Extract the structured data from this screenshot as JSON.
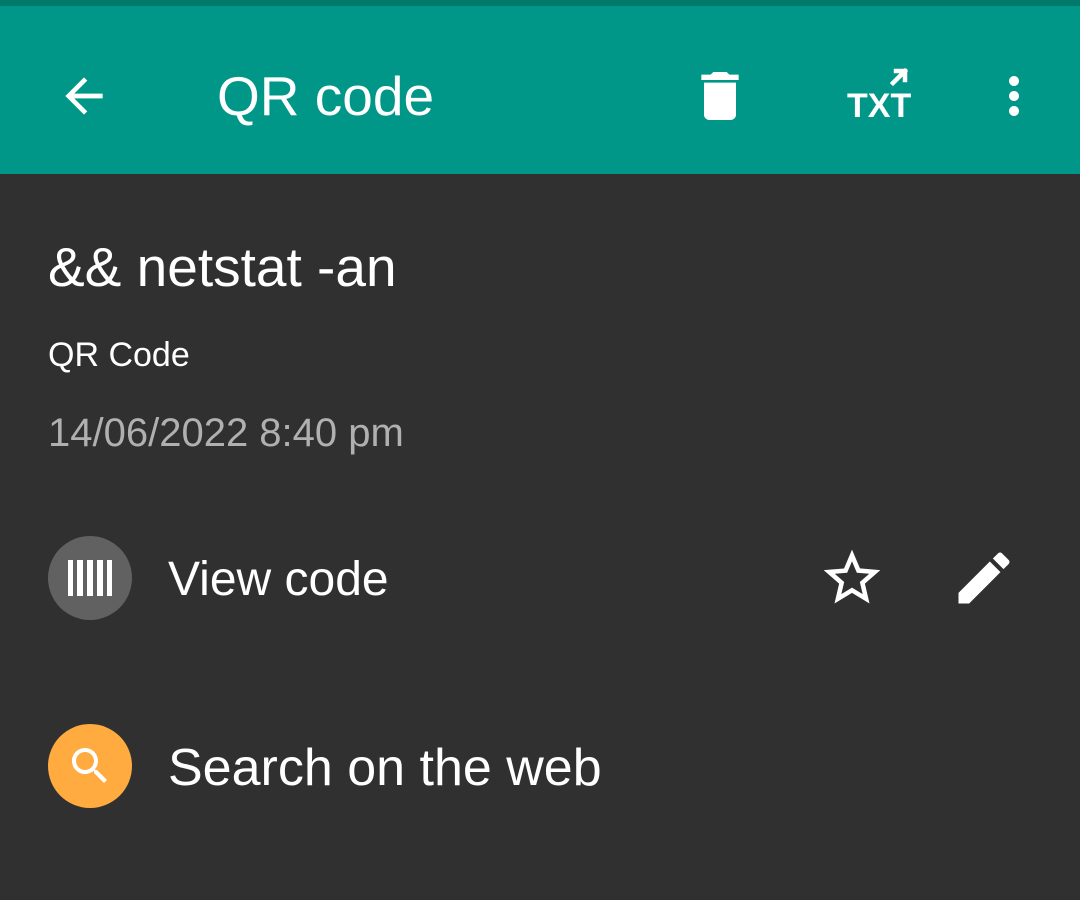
{
  "app_bar": {
    "title": "QR code",
    "background": "#009688",
    "txt_label": "TXT",
    "icons": {
      "back": "arrow-left-icon",
      "delete": "trash-icon",
      "export_txt": "txt-export-icon",
      "more": "more-vert-icon"
    }
  },
  "content": {
    "text": "&& netstat -an",
    "format": "QR Code",
    "date": "14/06/2022 8:40 pm"
  },
  "actions": {
    "view_code": {
      "label": "View code",
      "icon": "barcode-icon",
      "icon_bg": "#616161"
    },
    "favorite_icon": "star-outline-icon",
    "edit_icon": "pencil-icon",
    "search_web": {
      "label": "Search on the web",
      "icon": "search-icon",
      "icon_bg": "#ffab40"
    }
  },
  "colors": {
    "background": "#303030",
    "date_text": "#b0b0b0"
  }
}
